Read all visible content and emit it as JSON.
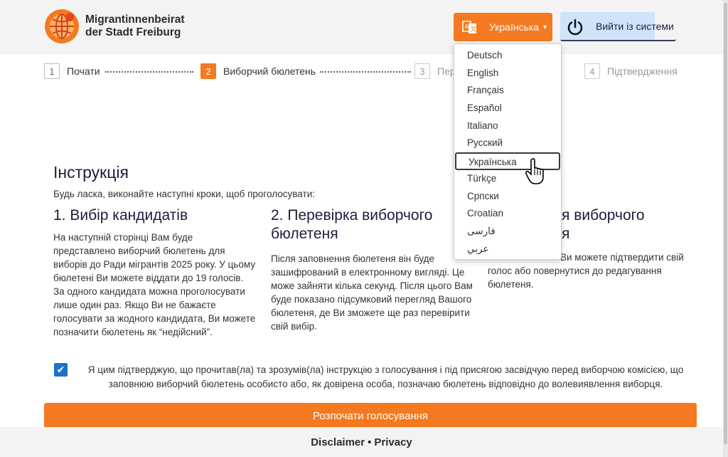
{
  "header": {
    "logo_line1": "Migrantinnenbeirat",
    "logo_line2": "der Stadt Freiburg",
    "language_button_label": "Українська",
    "logout_label": "Вийти із системи"
  },
  "steps": [
    {
      "num": "1",
      "label": "Почати"
    },
    {
      "num": "2",
      "label": "Виборчий бюлетень"
    },
    {
      "num": "3",
      "label": "Пер"
    },
    {
      "num": "4",
      "label": "Підтвердження"
    }
  ],
  "language_menu": {
    "items": [
      "Deutsch",
      "English",
      "Français",
      "Español",
      "Italiano",
      "Русский",
      "Українська",
      "Türkçe",
      "Српски",
      "Croatian",
      "فارسی",
      "عربي"
    ],
    "selected": "Українська"
  },
  "instructions": {
    "title": "Інструкція",
    "intro": "Будь ласка, виконайте наступні кроки, щоб проголосувати:",
    "col1_title": "1. Вибір кандидатів",
    "col1_text": "На наступній сторінці Вам буде представлено виборчий бюлетень для виборів до Ради мігрантів 2025 року. У цьому бюлетені Ви можете віддати до 19 голосів. За одного кандидата можна проголосувати лише один раз. Якщо Ви не бажаєте голосувати за жодного кандидата, Ви можете позначити бюлетень як “недійсний”.",
    "col2_title": "2. Перевірка виборчого бюлетеня",
    "col2_text": "Після заповнення бюлетеня він буде зашифрований в електронному вигляді. Це може зайняти кілька секунд. Після цього Вам буде показано підсумковий перегляд Вашого бюлетеня, де Ви зможете ще раз перевірити свій вибір.",
    "col3_title_visible": "я виборчого",
    "col3_title_line2": "я",
    "col3_text_line1": "Ви можете підтвердити свій",
    "col3_text_line2": "голос або повернутися до редагування",
    "col3_text_line3": "бюлетеня."
  },
  "confirmation": {
    "checked": true,
    "text": "Я цим підтверджую, що прочитав(ла) та зрозумів(ла) інструкцію з голосування і під присягою засвідчую перед виборчою комісією, що заповнюю виборчий бюлетень особисто або, як довірена особа, позначаю бюлетень відповідно до волевиявлення виборця."
  },
  "start_button_label": "Розпочати голосування",
  "footer": {
    "disclaimer": "Disclaimer",
    "separator": "•",
    "privacy": "Privacy"
  },
  "colors": {
    "accent": "#f47920",
    "checkbox": "#1a73c9",
    "logout_highlight": "#cfe3fa"
  }
}
